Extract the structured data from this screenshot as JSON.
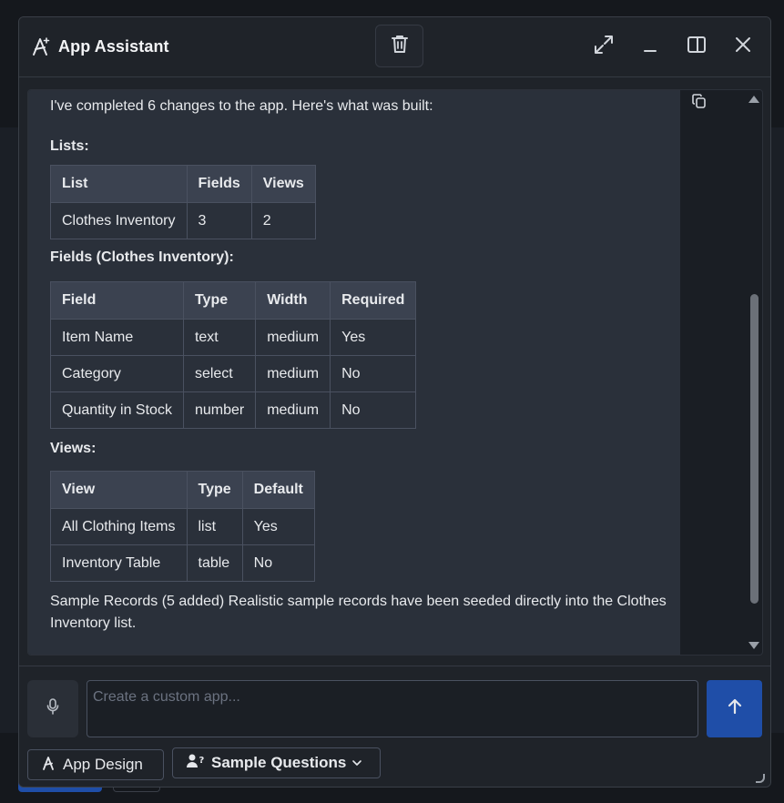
{
  "header": {
    "title": "App Assistant",
    "icons": [
      "app-assistant-icon",
      "trash-icon",
      "expand-icon",
      "minimize-icon",
      "split-panel-icon",
      "close-icon"
    ]
  },
  "message": {
    "intro": "I've completed 6 changes to the app. Here's what was built:",
    "lists_heading": "Lists:",
    "lists_table": {
      "headers": [
        "List",
        "Fields",
        "Views"
      ],
      "rows": [
        [
          "Clothes Inventory",
          "3",
          "2"
        ]
      ]
    },
    "fields_heading": "Fields (Clothes Inventory):",
    "fields_table": {
      "headers": [
        "Field",
        "Type",
        "Width",
        "Required"
      ],
      "rows": [
        [
          "Item Name",
          "text",
          "medium",
          "Yes"
        ],
        [
          "Category",
          "select",
          "medium",
          "No"
        ],
        [
          "Quantity in Stock",
          "number",
          "medium",
          "No"
        ]
      ]
    },
    "views_heading": "Views:",
    "views_table": {
      "headers": [
        "View",
        "Type",
        "Default"
      ],
      "rows": [
        [
          "All Clothing Items",
          "list",
          "Yes"
        ],
        [
          "Inventory Table",
          "table",
          "No"
        ]
      ]
    },
    "outro": "Sample Records (5 added) Realistic sample records have been seeded directly into the Clothes Inventory list."
  },
  "composer": {
    "placeholder": "Create a custom app...",
    "value": "",
    "app_design_label": "App Design",
    "sample_questions_label": "Sample Questions"
  },
  "colors": {
    "accent": "#1f4ea8",
    "panel": "#1f2329",
    "message_bg": "#2a303a",
    "table_header": "#3b4250"
  }
}
